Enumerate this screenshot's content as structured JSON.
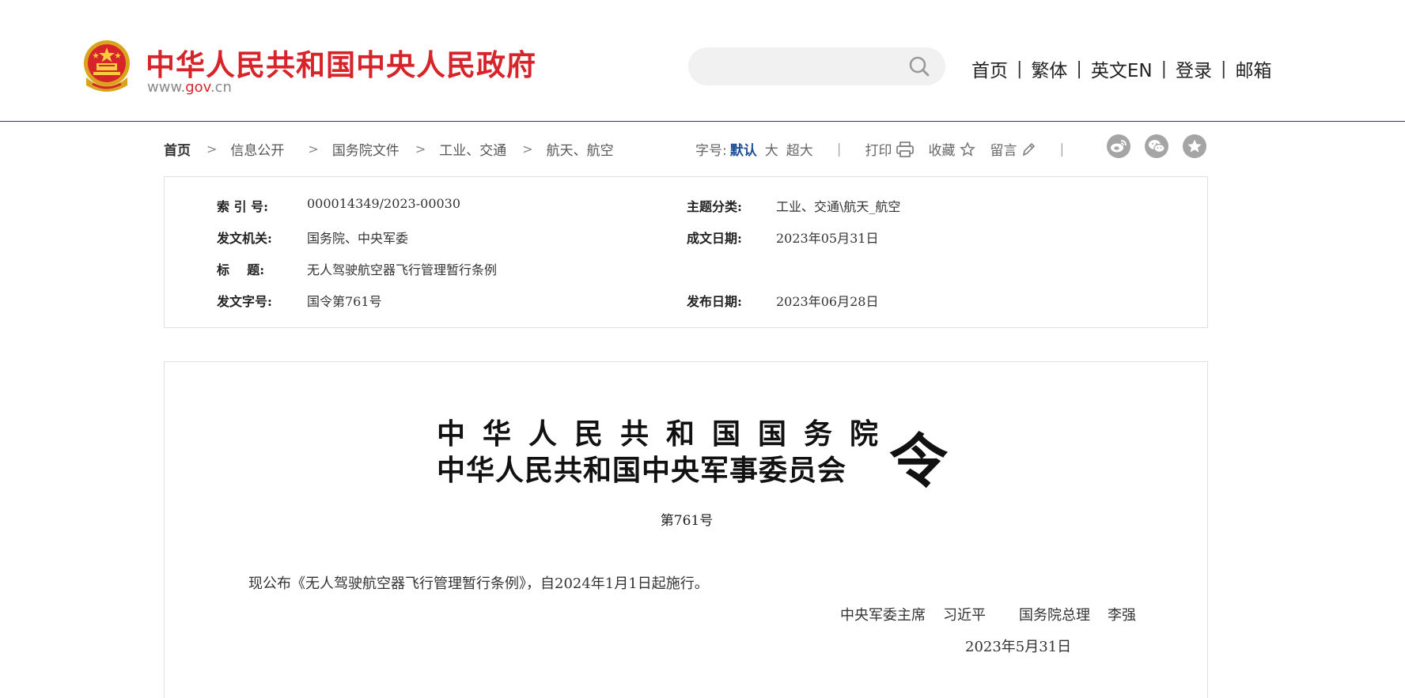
{
  "header": {
    "site_title": "中华人民共和国中央人民政府",
    "site_url_prefix": "www.",
    "site_url_domain": "gov",
    "site_url_suffix": ".cn",
    "search": {
      "placeholder": "",
      "value": "",
      "icon": "search-icon"
    },
    "nav": [
      "首页",
      "繁体",
      "英文EN",
      "登录",
      "邮箱"
    ],
    "nav_separator": "|"
  },
  "breadcrumb": [
    "首页",
    "信息公开",
    "国务院文件",
    "工业、交通",
    "航天、航空"
  ],
  "breadcrumb_separator": ">",
  "tools": {
    "font_size_label": "字号:",
    "font_sizes": [
      "默认",
      "大",
      "超大"
    ],
    "active_font_size": "默认",
    "separator": "|",
    "print": "打印",
    "favorite": "收藏",
    "comment": "留言",
    "share_icons": [
      "weibo-icon",
      "wechat-icon",
      "favorite-star-icon"
    ]
  },
  "info": {
    "index_no_label": "索 引 号:",
    "index_no": "000014349/2023-00030",
    "topic_label": "主题分类:",
    "topic": "工业、交通\\航天_航空",
    "issuer_label": "发文机关:",
    "issuer": "国务院、中央军委",
    "written_date_label": "成文日期:",
    "written_date": "2023年05月31日",
    "title_label": "标    题:",
    "title": "无人驾驶航空器飞行管理暂行条例",
    "doc_no_label": "发文字号:",
    "doc_no": "国令第761号",
    "publish_date_label": "发布日期:",
    "publish_date": "2023年06月28日"
  },
  "document": {
    "order_line1": "中华人民共和国国务院",
    "order_line2": "中华人民共和国中央军事委员会",
    "order_char": "令",
    "order_number": "第761号",
    "announcement": "现公布《无人驾驶航空器飞行管理暂行条例》，自2024年1月1日起施行。",
    "signer1_title": "中央军委主席",
    "signer1_name": "习近平",
    "signer2_title": "国务院总理",
    "signer2_name": "李强",
    "sign_date": "2023年5月31日"
  },
  "colors": {
    "brand_red": "#d7242b",
    "active_blue": "#1d4e96",
    "header_rule": "#1d3e78",
    "share_grey": "#a5a5a5"
  }
}
